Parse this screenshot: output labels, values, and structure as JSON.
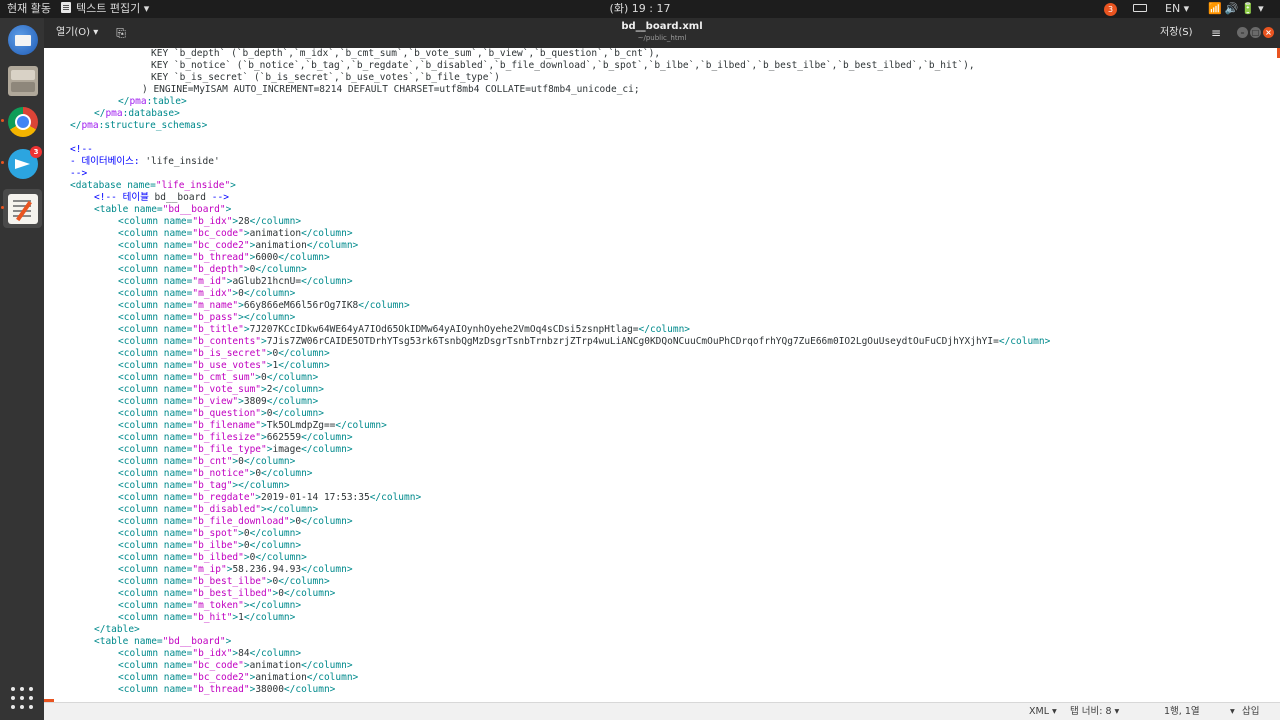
{
  "top_panel": {
    "activities": "현재 활동",
    "app_menu": "텍스트 편집기 ▾",
    "clock": "(화) 19 : 17",
    "notification_count": "3",
    "language": "EN ▾",
    "system_icons": "📶🔊🔋▾"
  },
  "dock": {
    "telegram_badge": "3",
    "icons": [
      "thunderbird-icon",
      "files-icon",
      "chrome-icon",
      "telegram-icon",
      "text-editor-icon",
      "show-applications-icon"
    ]
  },
  "headerbar": {
    "open_label": "열기(O) ▾",
    "new_doc_icon": "⎘",
    "title": "bd__board.xml",
    "subtitle": "~/public_html",
    "save_label": "저장(S)",
    "menu_icon": "≡",
    "minimize": "–",
    "maximize": "□",
    "close": "×"
  },
  "editor": {
    "lines": [
      {
        "indent": 107,
        "segs": [
          [
            "sql",
            "KEY `b_depth` (`b_depth`,`m_idx`,`b_cmt_sum`,`b_vote_sum`,`b_view`,`b_question`,`b_cnt`),"
          ]
        ]
      },
      {
        "indent": 107,
        "segs": [
          [
            "sql",
            "KEY `b_notice` (`b_notice`,`b_tag`,`b_regdate`,`b_disabled`,`b_file_download`,`b_spot`,`b_ilbe`,`b_ilbed`,`b_best_ilbe`,`b_best_ilbed`,`b_hit`),"
          ]
        ]
      },
      {
        "indent": 107,
        "segs": [
          [
            "sql",
            "KEY `b_is_secret` (`b_is_secret`,`b_use_votes`,`b_file_type`)"
          ]
        ]
      },
      {
        "indent": 98,
        "segs": [
          [
            "sql",
            ") ENGINE=MyISAM AUTO_INCREMENT=8214 DEFAULT CHARSET=utf8mb4 COLLATE=utf8mb4_unicode_ci;"
          ]
        ]
      },
      {
        "indent": 74,
        "segs": [
          [
            "tag",
            "</"
          ],
          [
            "ns",
            "pma"
          ],
          [
            "tag",
            ":table>"
          ]
        ]
      },
      {
        "indent": 50,
        "segs": [
          [
            "tag",
            "</"
          ],
          [
            "ns",
            "pma"
          ],
          [
            "tag",
            ":database>"
          ]
        ]
      },
      {
        "indent": 26,
        "segs": [
          [
            "tag",
            "</"
          ],
          [
            "ns",
            "pma"
          ],
          [
            "tag",
            ":structure_schemas>"
          ]
        ]
      },
      {
        "indent": 26,
        "segs": []
      },
      {
        "indent": 26,
        "segs": [
          [
            "comment",
            "<!--"
          ]
        ]
      },
      {
        "indent": 26,
        "segs": [
          [
            "comment",
            "- 데이터베이스: "
          ],
          [
            "text",
            "'life_inside'"
          ]
        ]
      },
      {
        "indent": 26,
        "segs": [
          [
            "comment",
            "-->"
          ]
        ]
      },
      {
        "indent": 26,
        "segs": [
          [
            "tag",
            "<database "
          ],
          [
            "attr",
            "name="
          ],
          [
            "val",
            "\"life_inside\""
          ],
          [
            "tag",
            ">"
          ]
        ]
      },
      {
        "indent": 50,
        "segs": [
          [
            "comment",
            "<!-- 테이블 "
          ],
          [
            "text",
            "bd__board"
          ],
          [
            "comment",
            " -->"
          ]
        ]
      },
      {
        "indent": 50,
        "segs": [
          [
            "tag",
            "<table "
          ],
          [
            "attr",
            "name="
          ],
          [
            "val",
            "\"bd__board\""
          ],
          [
            "tag",
            ">"
          ]
        ]
      },
      {
        "indent": 74,
        "col": [
          "b_idx",
          "28"
        ]
      },
      {
        "indent": 74,
        "col": [
          "bc_code",
          "animation"
        ]
      },
      {
        "indent": 74,
        "col": [
          "bc_code2",
          "animation"
        ]
      },
      {
        "indent": 74,
        "col": [
          "b_thread",
          "6000"
        ]
      },
      {
        "indent": 74,
        "col": [
          "b_depth",
          "0"
        ]
      },
      {
        "indent": 74,
        "col": [
          "m_id",
          "aGlub21hcnU="
        ]
      },
      {
        "indent": 74,
        "col": [
          "m_idx",
          "0"
        ]
      },
      {
        "indent": 74,
        "col": [
          "m_name",
          "66y866eM66l56rOg7IK8"
        ]
      },
      {
        "indent": 74,
        "col": [
          "b_pass",
          ""
        ]
      },
      {
        "indent": 74,
        "col": [
          "b_title",
          "7J207KCcIDkw64WE64yA7IOd65OkIDMw64yAIOynhOyehe2VmOq4sCDsi5zsnpHtlag="
        ]
      },
      {
        "indent": 74,
        "col": [
          "b_contents",
          "7Jis7ZW06rCAIDE5OTDrhYTsg53rk6TsnbQgMzDsgrTsnbTrnbzrjZTrp4wuLiANCg0KDQoNCuuCmOuPhCDrqofrhYQg7ZuE66m0IO2LgOuUseydtOuFuCDjhYXjhYI="
        ]
      },
      {
        "indent": 74,
        "col": [
          "b_is_secret",
          "0"
        ]
      },
      {
        "indent": 74,
        "col": [
          "b_use_votes",
          "1"
        ]
      },
      {
        "indent": 74,
        "col": [
          "b_cmt_sum",
          "0"
        ]
      },
      {
        "indent": 74,
        "col": [
          "b_vote_sum",
          "2"
        ]
      },
      {
        "indent": 74,
        "col": [
          "b_view",
          "3809"
        ]
      },
      {
        "indent": 74,
        "col": [
          "b_question",
          "0"
        ]
      },
      {
        "indent": 74,
        "col": [
          "b_filename",
          "Tk5OLmdpZg=="
        ]
      },
      {
        "indent": 74,
        "col": [
          "b_filesize",
          "662559"
        ]
      },
      {
        "indent": 74,
        "col": [
          "b_file_type",
          "image"
        ]
      },
      {
        "indent": 74,
        "col": [
          "b_cnt",
          "0"
        ]
      },
      {
        "indent": 74,
        "col": [
          "b_notice",
          "0"
        ]
      },
      {
        "indent": 74,
        "col": [
          "b_tag",
          ""
        ]
      },
      {
        "indent": 74,
        "col": [
          "b_regdate",
          "2019-01-14 17:53:35"
        ]
      },
      {
        "indent": 74,
        "col": [
          "b_disabled",
          ""
        ]
      },
      {
        "indent": 74,
        "col": [
          "b_file_download",
          "0"
        ]
      },
      {
        "indent": 74,
        "col": [
          "b_spot",
          "0"
        ]
      },
      {
        "indent": 74,
        "col": [
          "b_ilbe",
          "0"
        ]
      },
      {
        "indent": 74,
        "col": [
          "b_ilbed",
          "0"
        ]
      },
      {
        "indent": 74,
        "col": [
          "m_ip",
          "58.236.94.93"
        ]
      },
      {
        "indent": 74,
        "col": [
          "b_best_ilbe",
          "0"
        ]
      },
      {
        "indent": 74,
        "col": [
          "b_best_ilbed",
          "0"
        ]
      },
      {
        "indent": 74,
        "col": [
          "m_token",
          ""
        ]
      },
      {
        "indent": 74,
        "col": [
          "b_hit",
          "1"
        ]
      },
      {
        "indent": 50,
        "segs": [
          [
            "tag",
            "</table>"
          ]
        ]
      },
      {
        "indent": 50,
        "segs": [
          [
            "tag",
            "<table "
          ],
          [
            "attr",
            "name="
          ],
          [
            "val",
            "\"bd__board\""
          ],
          [
            "tag",
            ">"
          ]
        ]
      },
      {
        "indent": 74,
        "col": [
          "b_idx",
          "84"
        ]
      },
      {
        "indent": 74,
        "col": [
          "bc_code",
          "animation"
        ]
      },
      {
        "indent": 74,
        "col": [
          "bc_code2",
          "animation"
        ]
      },
      {
        "indent": 74,
        "col": [
          "b_thread",
          "38000"
        ]
      }
    ]
  },
  "statusbar": {
    "language": "XML ▾",
    "tab_width": "탭 너비: 8 ▾",
    "position": "1행, 1열",
    "arrow": "▾",
    "mode": "삽입"
  },
  "colors": {
    "tag": "#008a8c",
    "namespace": "#a020f0",
    "attr_value": "#c000c0",
    "comment": "#0000ff",
    "accent": "#e95420"
  }
}
